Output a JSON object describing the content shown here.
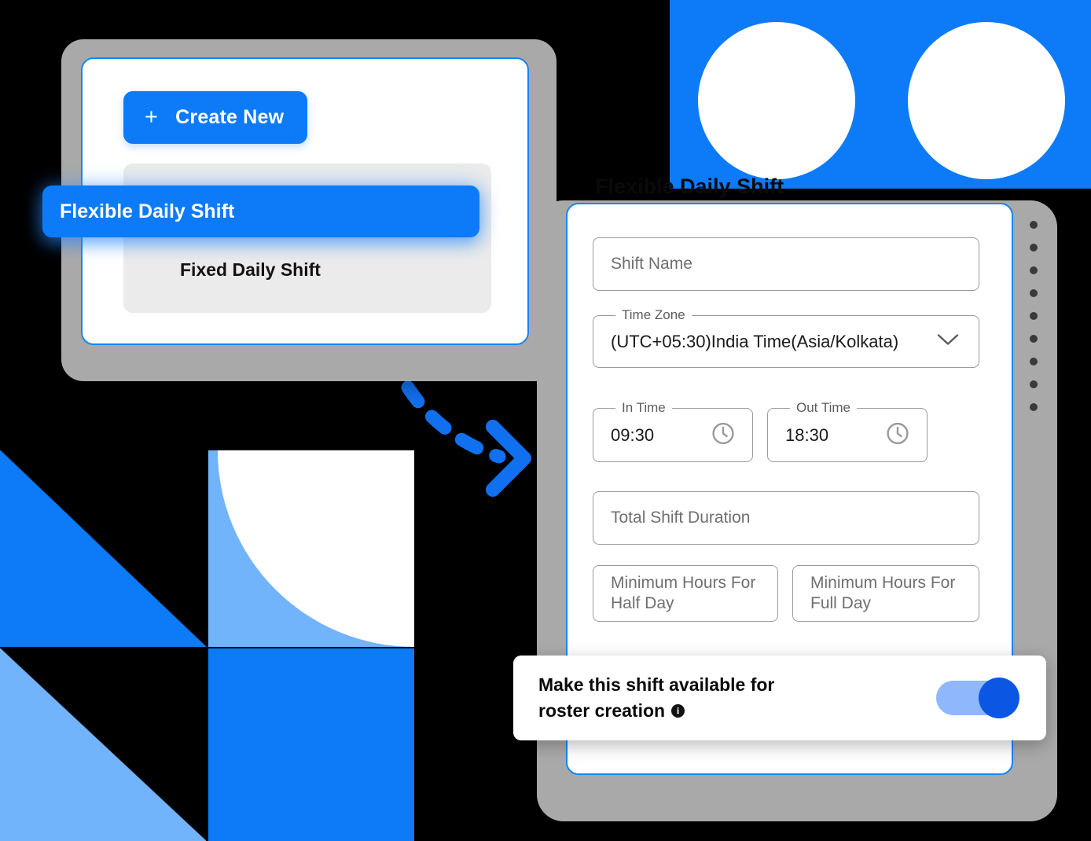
{
  "left_panel": {
    "create_button": {
      "label": "Create New",
      "icon": "plus-icon"
    },
    "shift_types": [
      {
        "label": "Fixed Daily Shift",
        "selected": false
      },
      {
        "label": "Flexible Daily Shift",
        "selected": true
      }
    ]
  },
  "right_panel": {
    "title": "Flexible Daily Shift",
    "fields": {
      "shift_name": {
        "label": "",
        "placeholder": "Shift Name",
        "value": ""
      },
      "time_zone": {
        "label": "Time Zone",
        "value": "(UTC+05:30)India Time(Asia/Kolkata)",
        "icon": "chevron-down-icon"
      },
      "in_time": {
        "label": "In Time",
        "value": "09:30",
        "icon": "clock-icon"
      },
      "out_time": {
        "label": "Out Time",
        "value": "18:30",
        "icon": "clock-icon"
      },
      "total_shift_duration": {
        "placeholder": "Total Shift Duration",
        "value": ""
      },
      "minimum_hours_half_day": {
        "placeholder": "Minimum Hours For Half Day",
        "value": ""
      },
      "minimum_hours_full_day": {
        "placeholder": "Minimum Hours For Full Day",
        "value": ""
      }
    }
  },
  "toggle_card": {
    "label_line1": "Make this shift available for",
    "label_line2": "roster creation",
    "info_icon_glyph": "i",
    "toggle_state": "on"
  },
  "colors": {
    "brand_blue": "#0D7BF7",
    "light_blue": "#72B4FB",
    "toggle_track": "#8FB8FC",
    "toggle_knob": "#0B57E3",
    "frame_gray": "#A9A9A9",
    "list_gray": "#EBEBEB",
    "field_border": "#9A9A9A",
    "background": "#000000"
  }
}
